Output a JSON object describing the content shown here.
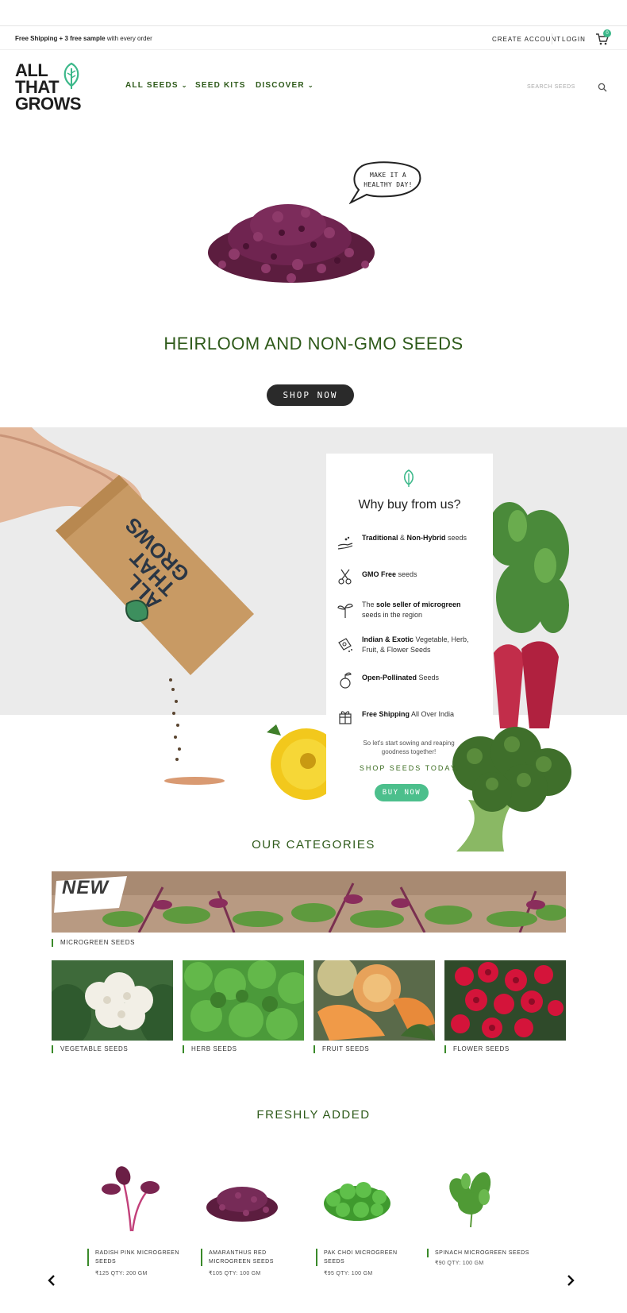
{
  "topbar": {
    "shipping_bold": "Free Shipping + 3 free sample",
    "shipping_rest": " with every order",
    "create_account": "CREATE ACCOUNT",
    "login": "LOGIN",
    "cart_count": "0"
  },
  "header": {
    "logo_line1": "ALL",
    "logo_line2": "THAT",
    "logo_line3": "GROWS",
    "nav": [
      {
        "label": "ALL SEEDS",
        "dropdown": true
      },
      {
        "label": "SEED KITS",
        "dropdown": false
      },
      {
        "label": "DISCOVER",
        "dropdown": true
      }
    ],
    "search_placeholder": "SEARCH SEEDS"
  },
  "hero": {
    "bubble_line1": "MAKE IT A",
    "bubble_line2": "HEALTHY DAY!",
    "title": "HEIRLOOM AND NON-GMO SEEDS",
    "button": "SHOP NOW"
  },
  "why": {
    "title": "Why buy from us?",
    "items": [
      {
        "bold1": "Traditional",
        "mid": " & ",
        "bold2": "Non-Hybrid",
        "rest": " seeds",
        "icon": "hand-seed-icon"
      },
      {
        "bold1": "GMO Free",
        "mid": "",
        "bold2": "",
        "rest": " seeds",
        "icon": "scissors-icon"
      },
      {
        "pre": "The ",
        "bold1": "sole seller of microgreen",
        "mid": "",
        "bold2": "",
        "rest": " seeds in the region",
        "icon": "sprout-icon"
      },
      {
        "bold1": "Indian & Exotic",
        "mid": "",
        "bold2": "",
        "rest": " Vegetable, Herb, Fruit, & Flower Seeds",
        "icon": "seed-packet-icon"
      },
      {
        "bold1": "Open-Pollinated",
        "mid": "",
        "bold2": "",
        "rest": " Seeds",
        "icon": "seedling-icon"
      },
      {
        "bold1": "Free Shipping",
        "mid": "",
        "bold2": "",
        "rest": " All Over India",
        "icon": "gift-box-icon"
      }
    ],
    "sow_text": "So let's start sowing and reaping goodness together!",
    "shop_today": "SHOP SEEDS TODAY.",
    "button": "BUY NOW"
  },
  "categories": {
    "title": "OUR CATEGORIES",
    "banner_badge": "NEW",
    "banner_label": "MICROGREEN SEEDS",
    "items": [
      {
        "label": "VEGETABLE SEEDS"
      },
      {
        "label": "HERB SEEDS"
      },
      {
        "label": "FRUIT SEEDS"
      },
      {
        "label": "FLOWER SEEDS"
      }
    ]
  },
  "fresh": {
    "title": "FRESHLY ADDED",
    "products": [
      {
        "name_line1": "RADISH PINK MICROGREEN",
        "name_line2": "SEEDS",
        "price": "₹125 QTY: 200 GM"
      },
      {
        "name_line1": "AMARANTHUS RED",
        "name_line2": "MICROGREEN SEEDS",
        "price": "₹105 QTY: 100 GM"
      },
      {
        "name_line1": "PAK CHOI MICROGREEN",
        "name_line2": "SEEDS",
        "price": "₹95 QTY: 100 GM"
      },
      {
        "name_line1": "SPINACH MICROGREEN SEEDS",
        "name_line2": "",
        "price": "₹90 QTY: 100 GM"
      }
    ]
  },
  "colors": {
    "brand_green": "#2e5a1a",
    "accent_mint": "#4cbf8c",
    "dark_button": "#2a2a2a"
  }
}
